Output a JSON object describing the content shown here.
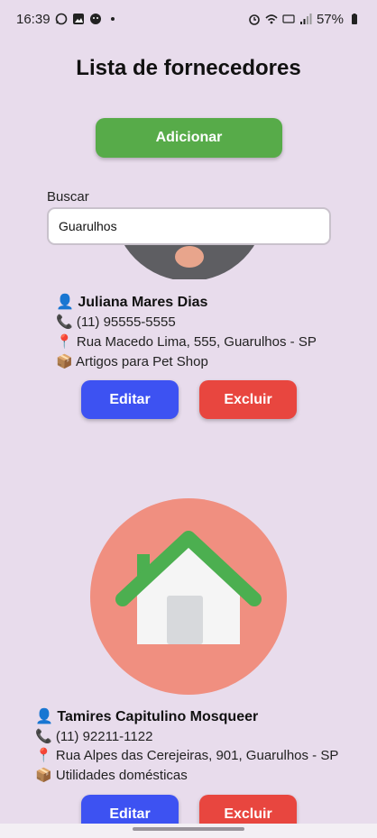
{
  "status": {
    "time": "16:39",
    "battery": "57%"
  },
  "page": {
    "title": "Lista de fornecedores"
  },
  "actions": {
    "add_label": "Adicionar"
  },
  "search": {
    "label": "Buscar",
    "value": "Guarulhos"
  },
  "suppliers": [
    {
      "name": "Juliana Mares Dias",
      "phone": "(11) 95555-5555",
      "address": "Rua Macedo Lima, 555, Guarulhos - SP",
      "category": "Artigos para Pet Shop",
      "edit_label": "Editar",
      "delete_label": "Excluir"
    },
    {
      "name": "Tamires Capitulino Mosqueer",
      "phone": "(11) 92211-1122",
      "address": "Rua Alpes das Cerejeiras, 901, Guarulhos - SP",
      "category": "Utilidades domésticas",
      "edit_label": "Editar",
      "delete_label": "Excluir"
    }
  ],
  "icons": {
    "person": "👤",
    "phone": "📞",
    "pin": "📍",
    "box": "📦"
  },
  "colors": {
    "background": "#e8dcec",
    "add": "#57ab49",
    "edit": "#3d52f2",
    "delete": "#e8463f",
    "home_circle": "#f08f80",
    "roof": "#4caf50"
  }
}
